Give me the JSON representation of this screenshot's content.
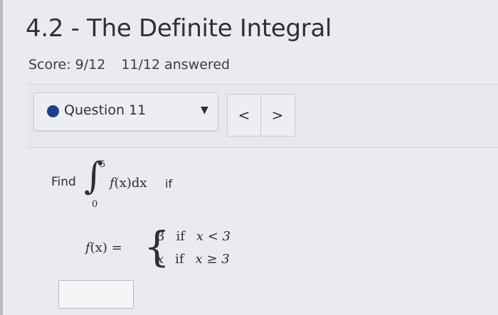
{
  "page": {
    "title": "4.2 - The Definite Integral",
    "score": "Score: 9/12",
    "answered": "11/12 answered"
  },
  "question_nav": {
    "selected": "Question 11",
    "status_color": "#1f3f8e",
    "caret_icon": "caret-down-icon",
    "prev_label": "<",
    "next_label": ">"
  },
  "problem": {
    "find": "Find",
    "integral_upper": "5",
    "integral_lower": "0",
    "integrand_f": "f",
    "integrand_rest": "(x)dx",
    "if": "if",
    "fdef_lhs_f": "f",
    "fdef_lhs_rest": "(x) =",
    "case1_value": "3",
    "case1_if": "if",
    "case1_cond": "x < 3",
    "case2_value": "x",
    "case2_if": "if",
    "case2_cond": "x ≥ 3"
  },
  "answer": {
    "value": ""
  }
}
